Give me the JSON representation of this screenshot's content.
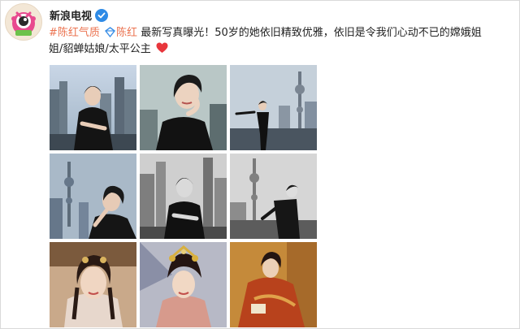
{
  "post": {
    "username": "新浪电视",
    "topic1": "#陈红气质",
    "topic2": "陈红",
    "text_line1": "最新写真曝光！50岁的她依旧精致优雅，依旧是令我们心动不已的嫦娥姐",
    "text_line2": "姐/貂蝉姑娘/太平公主"
  },
  "colors": {
    "topic": "#eb7350",
    "verified_badge": "#2f8be6",
    "heart": "#e8363c"
  },
  "icons": {
    "avatar": "tv-mascot-avatar",
    "verified": "verified-icon",
    "topic": "superchat-diamond-icon",
    "heart": "heart-icon"
  },
  "photos": [
    "city-skyline-portrait-1",
    "close-up-portrait-2",
    "rooftop-full-body-3",
    "tower-profile-4",
    "grayscale-skyline-5",
    "grayscale-tower-6",
    "costume-portrait-7",
    "headdress-portrait-8",
    "red-robe-portrait-9"
  ]
}
